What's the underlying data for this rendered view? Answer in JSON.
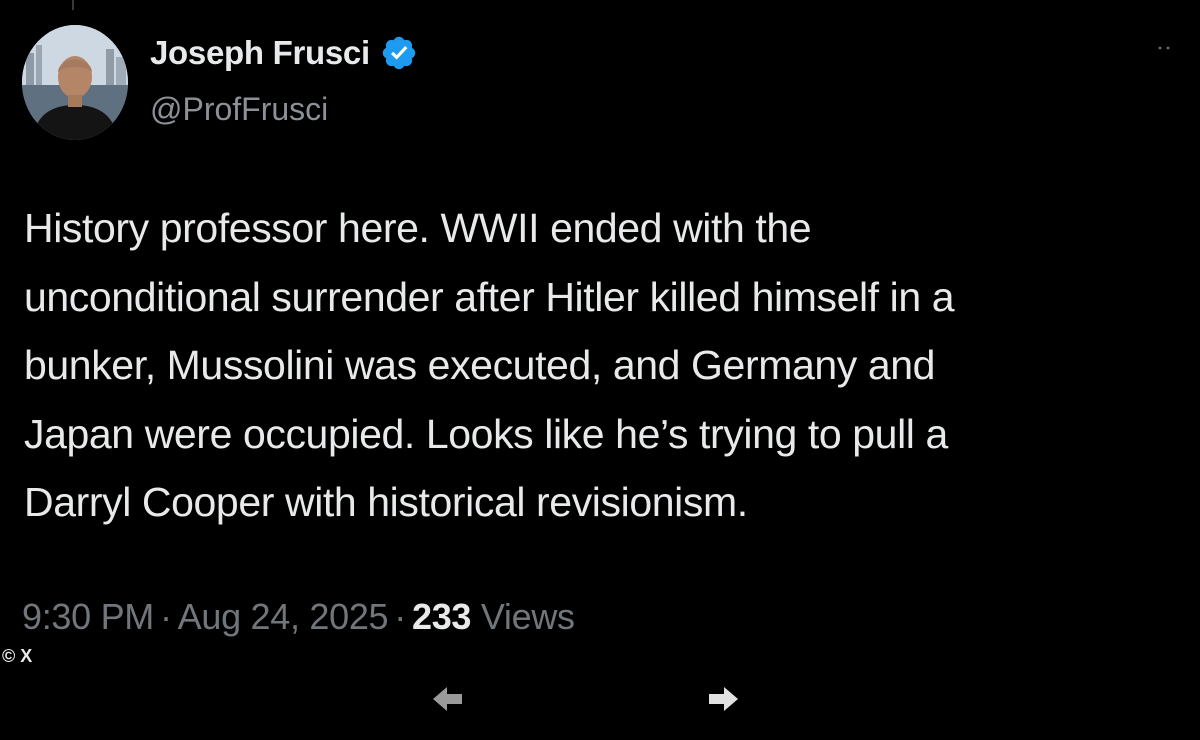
{
  "author": {
    "display_name": "Joseph Frusci",
    "handle": "@ProfFrusci",
    "verified": true,
    "verified_color": "#1d9bf0",
    "avatar_icon": "profile-photo"
  },
  "tweet": {
    "lines": [
      "History professor here.  WWII ended with the",
      "unconditional surrender after Hitler killed himself in a",
      "bunker, Mussolini was executed, and Germany and",
      "Japan were occupied.  Looks like he’s trying to pull a",
      "Darryl Cooper with historical revisionism."
    ],
    "time": "9:30 PM",
    "separator": "·",
    "date": "Aug 24, 2025",
    "views_count": "233",
    "views_label": "Views"
  },
  "watermark": {
    "text": "© X"
  },
  "navigation": {
    "prev_icon": "arrow-left-icon",
    "next_icon": "arrow-right-icon"
  },
  "colors": {
    "background": "#000000",
    "primary_text": "#e7e9ea",
    "secondary_text": "#71767b",
    "accent": "#1d9bf0"
  }
}
